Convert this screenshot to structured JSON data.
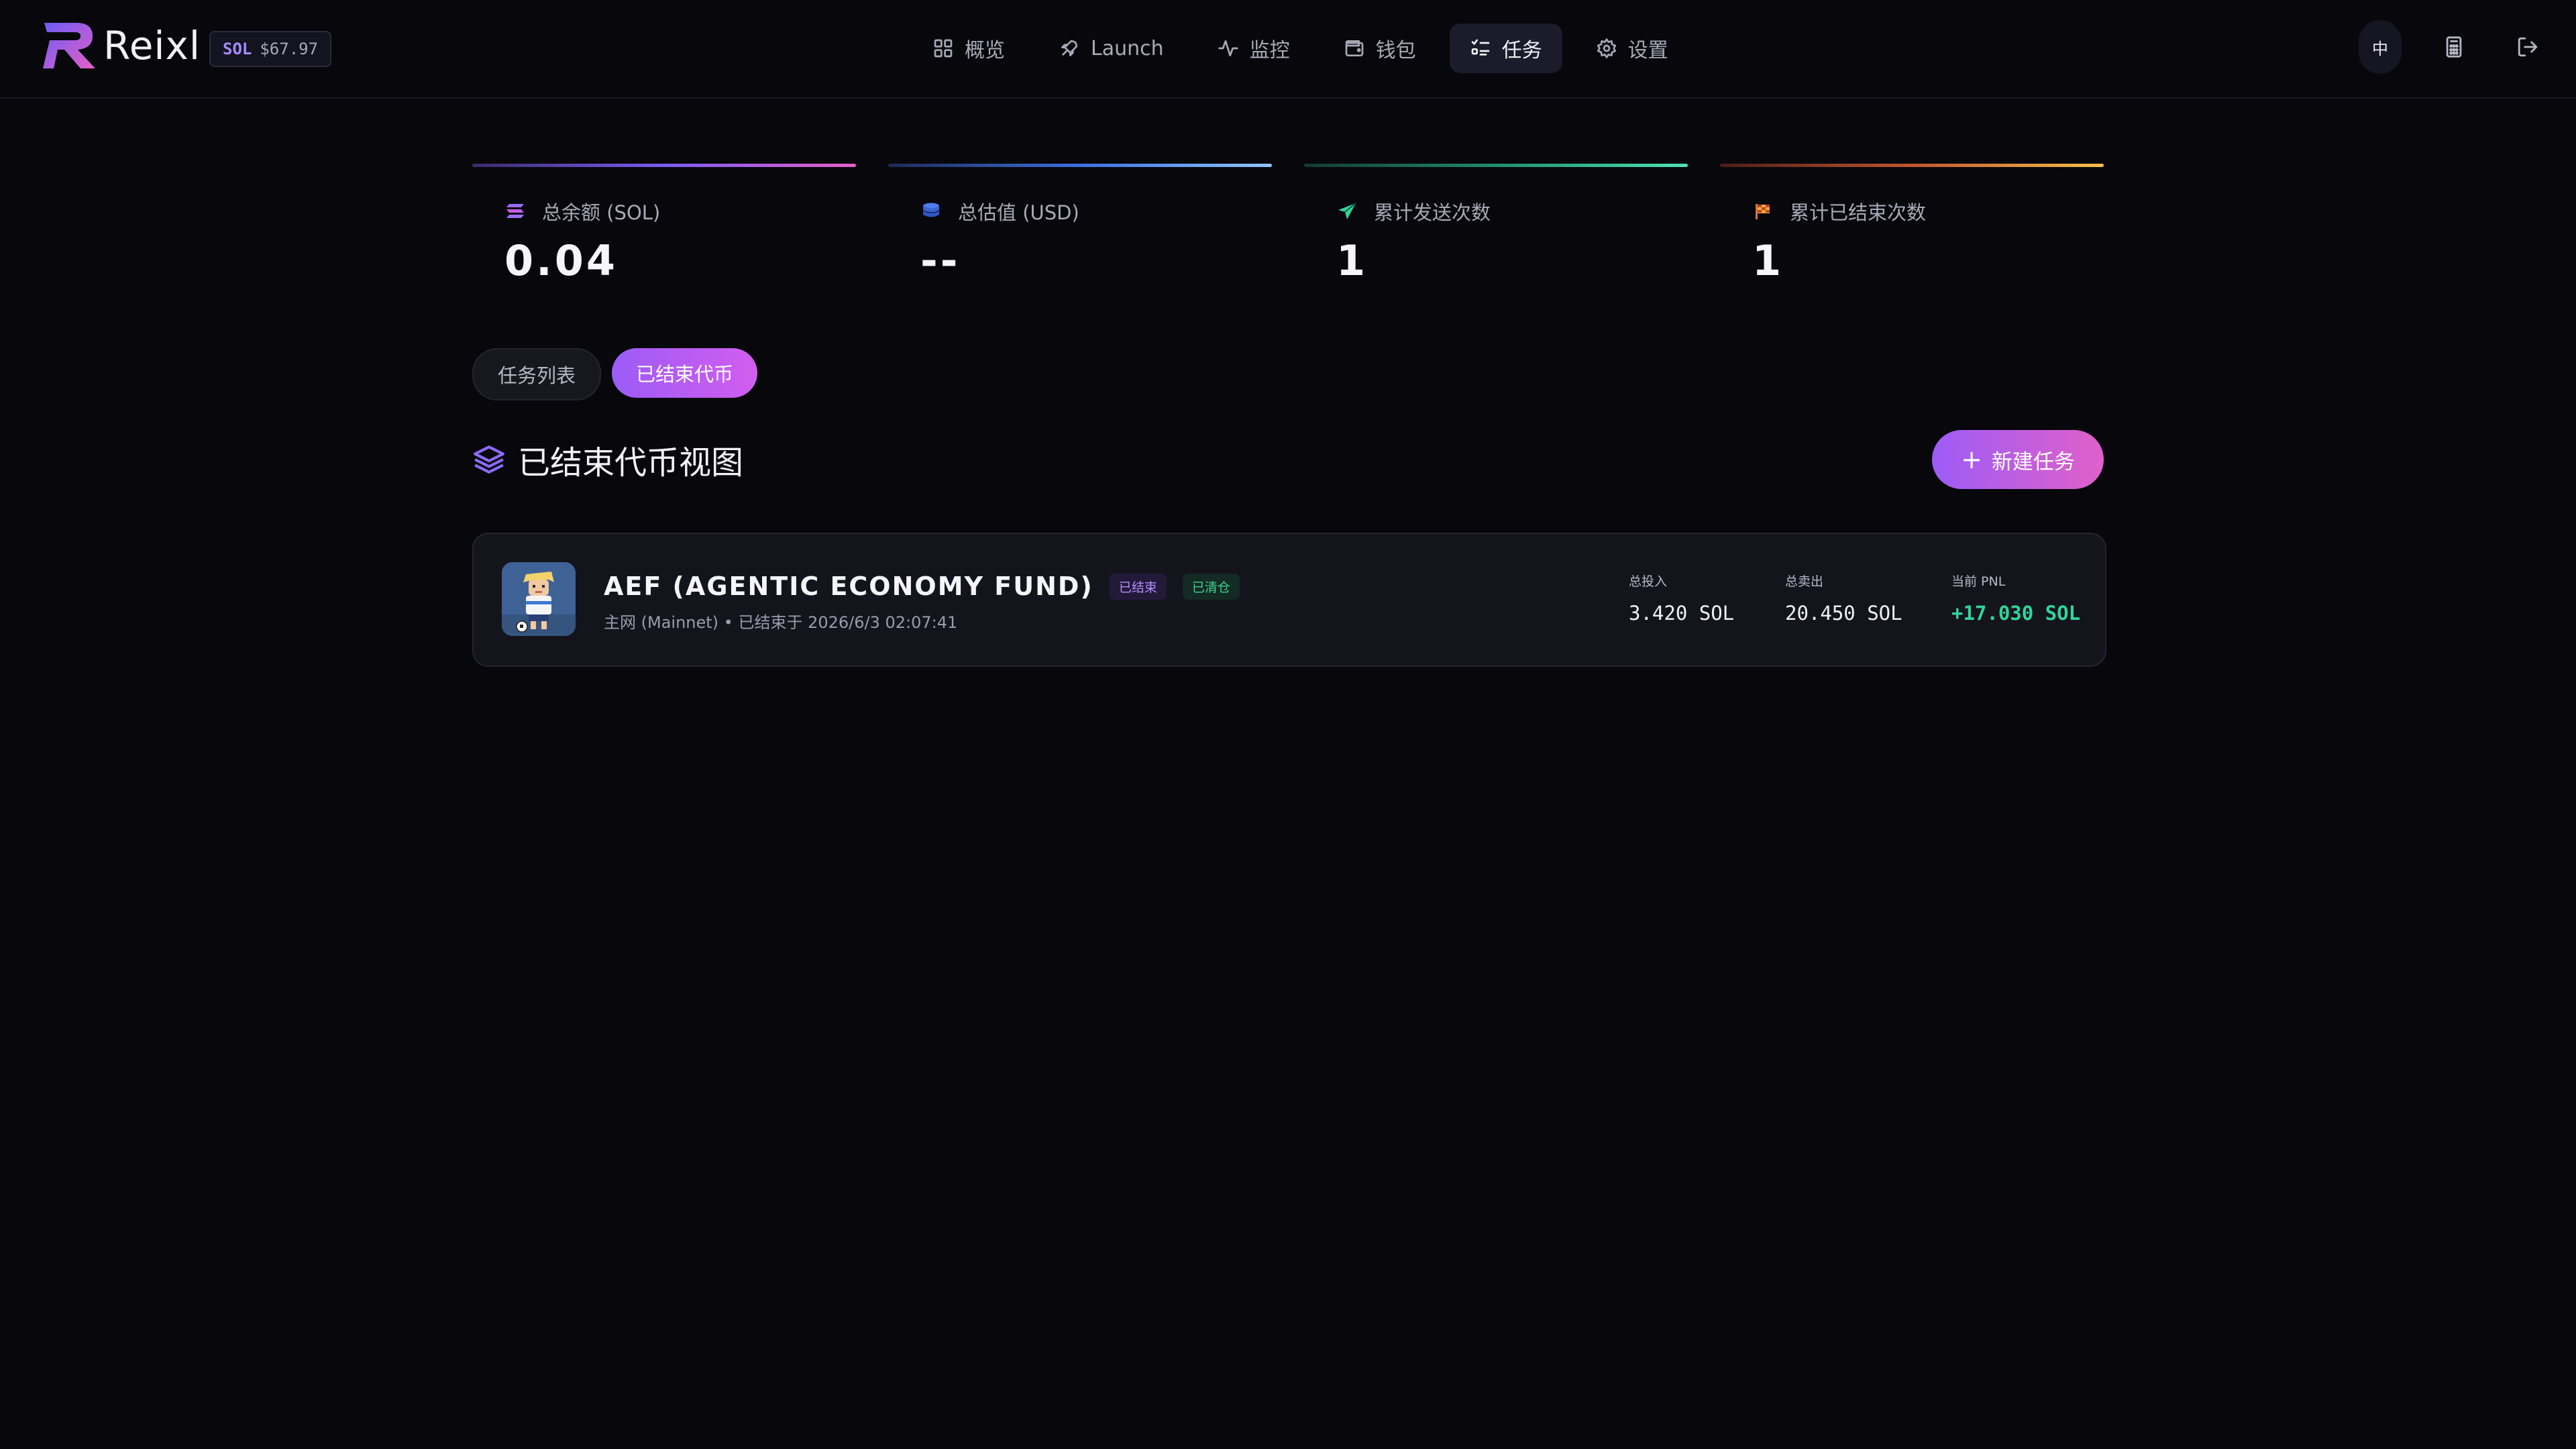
{
  "header": {
    "brand": "Reixl",
    "sol_symbol": "SOL",
    "sol_price": "$67.97",
    "nav": [
      {
        "label": "概览",
        "icon": "grid-icon"
      },
      {
        "label": "Launch",
        "icon": "rocket-icon"
      },
      {
        "label": "监控",
        "icon": "activity-icon"
      },
      {
        "label": "钱包",
        "icon": "wallet-icon"
      },
      {
        "label": "任务",
        "icon": "list-check-icon",
        "active": true
      },
      {
        "label": "设置",
        "icon": "gear-icon"
      }
    ],
    "lang_label": "中",
    "tools": [
      "calculator-icon",
      "logout-icon"
    ]
  },
  "stats": [
    {
      "label": "总余额 (SOL)",
      "value": "0.04",
      "icon": "solana-icon",
      "accent_from": "#7b5cf6",
      "accent_to": "#e75fc4"
    },
    {
      "label": "总估值 (USD)",
      "value": "--",
      "icon": "coins-icon",
      "accent_from": "#3b5fd6",
      "accent_to": "#8ec5ff"
    },
    {
      "label": "累计发送次数",
      "value": "1",
      "icon": "send-icon",
      "accent_from": "#1f8f6a",
      "accent_to": "#4fe3b0"
    },
    {
      "label": "累计已结束次数",
      "value": "1",
      "icon": "flag-icon",
      "accent_from": "#b8442d",
      "accent_to": "#f7c04a"
    }
  ],
  "tabs": [
    {
      "label": "任务列表",
      "active": false
    },
    {
      "label": "已结束代币",
      "active": true
    }
  ],
  "section": {
    "title": "已结束代币视图",
    "new_button": "新建任务"
  },
  "cards": [
    {
      "name": "AEF (AGENTIC ECONOMY FUND)",
      "badge_ended": "已结束",
      "badge_cleared": "已清仓",
      "subtitle": "主网 (Mainnet) • 已结束于 2026/6/3 02:07:41",
      "invest_label": "总投入",
      "invest_value": "3.420 SOL",
      "sold_label": "总卖出",
      "sold_value": "20.450 SOL",
      "pnl_label": "当前 PNL",
      "pnl_value": "+17.030 SOL"
    }
  ],
  "colors": {
    "background": "#07070c",
    "accent_purple": "#9b5cf6",
    "accent_pink": "#e060c8",
    "positive": "#2fd69a"
  }
}
